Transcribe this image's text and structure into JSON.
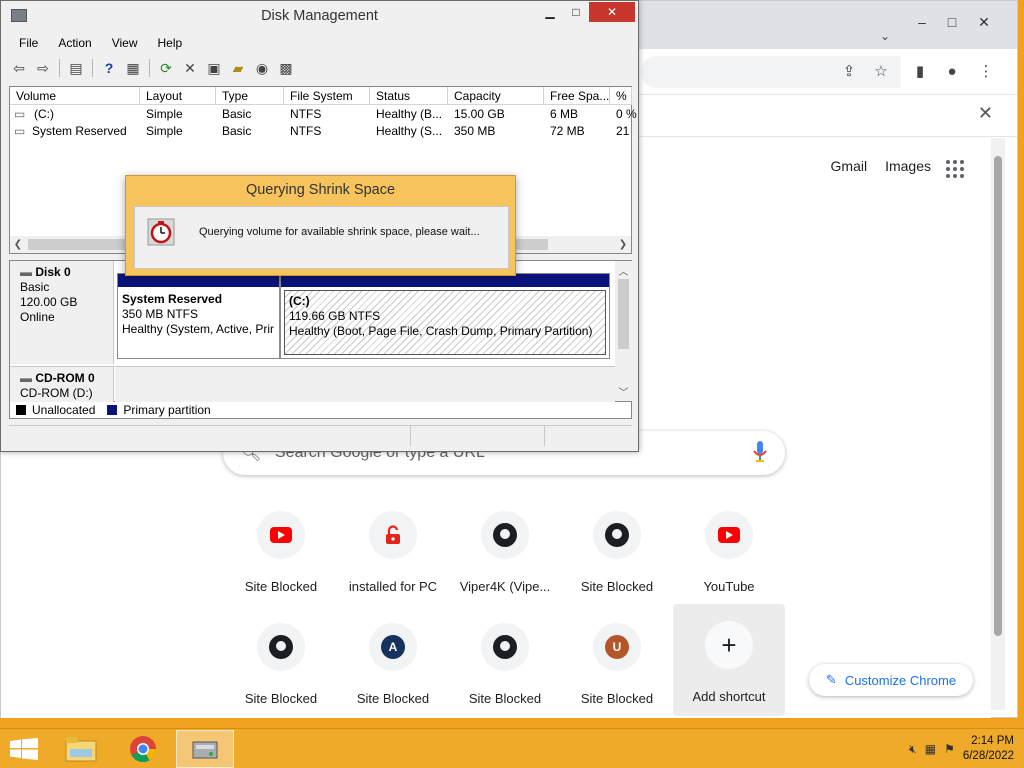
{
  "disk_management": {
    "title": "Disk Management",
    "menu": [
      "File",
      "Action",
      "View",
      "Help"
    ],
    "columns": [
      "Volume",
      "Layout",
      "Type",
      "File System",
      "Status",
      "Capacity",
      "Free Spa...",
      "% F"
    ],
    "volumes": [
      {
        "volume": "(C:)",
        "layout": "Simple",
        "type": "Basic",
        "fs": "NTFS",
        "status": "Healthy (B...",
        "capacity": "15.00 GB",
        "free": "6 MB",
        "pct": "0 %"
      },
      {
        "volume": "System Reserved",
        "layout": "Simple",
        "type": "Basic",
        "fs": "NTFS",
        "status": "Healthy (S...",
        "capacity": "350 MB",
        "free": "72 MB",
        "pct": "21"
      }
    ],
    "disk0": {
      "name": "Disk 0",
      "type": "Basic",
      "size": "120.00 GB",
      "state": "Online",
      "partitions": [
        {
          "name": "System Reserved",
          "size": "350 MB NTFS",
          "status": "Healthy (System, Active, Prir"
        },
        {
          "name": "(C:)",
          "size": "119.66 GB NTFS",
          "status": "Healthy (Boot, Page File, Crash Dump, Primary Partition)"
        }
      ]
    },
    "cdrom0": {
      "name": "CD-ROM 0",
      "sub": "CD-ROM (D:)"
    },
    "legend": [
      {
        "label": "Unallocated",
        "color": "#000000"
      },
      {
        "label": "Primary partition",
        "color": "#0a137b"
      }
    ]
  },
  "dialog": {
    "title": "Querying Shrink Space",
    "message": "Querying volume for available shrink space, please wait..."
  },
  "chrome": {
    "links": {
      "gmail": "Gmail",
      "images": "Images"
    },
    "search_placeholder": "Search Google or type a URL",
    "shortcuts": [
      {
        "label": "Site Blocked",
        "icon": "youtube-icon"
      },
      {
        "label": "installed for PC",
        "icon": "lock-icon"
      },
      {
        "label": "Viper4K (Vipe...",
        "icon": "github-icon"
      },
      {
        "label": "Site Blocked",
        "icon": "github-icon"
      },
      {
        "label": "YouTube",
        "icon": "youtube-icon"
      },
      {
        "label": "Site Blocked",
        "icon": "github-icon"
      },
      {
        "label": "Site Blocked",
        "icon": "letter-a-icon",
        "letter": "A",
        "color": "#17325c"
      },
      {
        "label": "Site Blocked",
        "icon": "github-icon"
      },
      {
        "label": "Site Blocked",
        "icon": "letter-u-icon",
        "letter": "U",
        "color": "#b5552a"
      },
      {
        "label": "Add shortcut",
        "icon": "plus-icon"
      }
    ],
    "customize_label": "Customize Chrome"
  },
  "taskbar": {
    "time": "2:14 PM",
    "date": "6/28/2022"
  }
}
